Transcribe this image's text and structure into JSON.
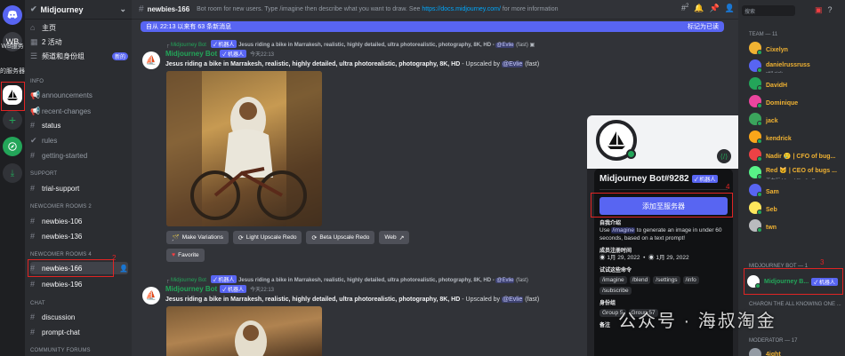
{
  "servers": {
    "items": [
      {
        "label": "discord-logo-icon"
      },
      {
        "label": "WB"
      },
      {
        "label": "Midjourney"
      },
      {
        "label": "add-server-icon"
      },
      {
        "label": "explore-icon"
      },
      {
        "label": "download-icon"
      }
    ],
    "labels": [
      "WB服务",
      "的服务器"
    ]
  },
  "guild": {
    "name": "Midjourney"
  },
  "channels": {
    "top": [
      {
        "label": "主页"
      },
      {
        "label": "2 活动"
      },
      {
        "label": "频道和身份组",
        "badge": "新的"
      }
    ],
    "cat_info": "INFO",
    "info": [
      {
        "label": "announcements"
      },
      {
        "label": "recent-changes"
      },
      {
        "label": "status"
      },
      {
        "label": "rules"
      },
      {
        "label": "getting-started"
      }
    ],
    "cat_support": "SUPPORT",
    "support": [
      {
        "label": "trial-support"
      }
    ],
    "cat_newcomer2": "NEWCOMER ROOMS 2",
    "newcomer2": [
      {
        "label": "newbies-106"
      },
      {
        "label": "newbies-136"
      }
    ],
    "cat_newcomer4": "NEWCOMER ROOMS 4",
    "newcomer4": [
      {
        "label": "newbies-166"
      },
      {
        "label": "newbies-196"
      }
    ],
    "cat_chat": "CHAT",
    "chat": [
      {
        "label": "discussion"
      },
      {
        "label": "prompt-chat"
      }
    ],
    "cat_forums": "COMMUNITY FORUMS"
  },
  "topbar": {
    "channel": "newbies-166",
    "topic": "Bot room for new users. Type /imagine then describe what you want to draw. See",
    "link": "https://docs.midjourney.com/",
    "topic_tail": "for more information",
    "threads_count": "2",
    "search_placeholder": "搜索"
  },
  "unread": {
    "text": "自从 22:13 以来有 63 条新消息",
    "mark": "标记为已读"
  },
  "messages": [
    {
      "reply_bot": "Midjourney Bot",
      "reply_badge": "✓ 机器人",
      "reply_text": "Jesus riding a bike in Marrakesh, realistic, highly detailed, ultra photorealistic, photography, 8K, HD -",
      "reply_mention": "@Evlie",
      "reply_tail": "(fast)",
      "author": "Midjourney Bot",
      "badge": "✓ 机器人",
      "time": "今天22:13",
      "prompt": "Jesus riding a bike in Marrakesh, realistic, highly detailed, ultra photorealistic, photography, 8K, HD",
      "tail": "- Upscaled by",
      "mention": "@Evlie",
      "speed": "(fast)",
      "buttons": [
        {
          "label": "Make Variations",
          "icon": "wand-icon"
        },
        {
          "label": "Light Upscale Redo",
          "icon": "refresh-icon"
        },
        {
          "label": "Beta Upscale Redo",
          "icon": "refresh-icon"
        },
        {
          "label": "Web",
          "icon": "external-link-icon"
        }
      ],
      "favorite": "Favorite"
    },
    {
      "reply_bot": "Midjourney Bot",
      "reply_badge": "✓ 机器人",
      "reply_text": "Jesus riding a bike in Marrakesh, realistic, highly detailed, ultra photorealistic, photography, 8K, HD -",
      "reply_mention": "@Evlie",
      "reply_tail": "(fast)",
      "author": "Midjourney Bot",
      "badge": "✓ 机器人",
      "time": "今天22:13",
      "prompt": "Jesus riding a bike in Marrakesh, realistic, highly detailed, ultra photorealistic, photography, 8K, HD",
      "tail": "- Upscaled by",
      "mention": "@Evlie",
      "speed": "(fast)"
    }
  ],
  "popout": {
    "name": "Midjourney Bot#9282",
    "badge": "✓ 机器人",
    "add_button": "添加至服务器",
    "about_title": "自我介绍",
    "about_pre": "Use",
    "about_cmd": "/imagine",
    "about_post": "to generate an image in under 60 seconds, based on a text prompt!",
    "since_title": "成员注册时间",
    "since_discord": "1月 29, 2022",
    "since_server": "1月 29, 2022",
    "commands_title": "试试这些命令",
    "commands": [
      "/imagine",
      "/blend",
      "/settings",
      "/info",
      "/subscribe"
    ],
    "roles_title": "身份组",
    "roles_partial": "Group 5",
    "roles_partial2": "Group 57",
    "note_title": "备注"
  },
  "members": {
    "team_header": "TEAM — 11",
    "team": [
      {
        "name": "Cixelyn",
        "color": "#f0b232"
      },
      {
        "name": "danielrussruss",
        "sub": "still sick",
        "color": "#f0b232"
      },
      {
        "name": "DavidH",
        "color": "#f0b232"
      },
      {
        "name": "Dominique",
        "color": "#f0b232"
      },
      {
        "name": "jack",
        "color": "#f0b232"
      },
      {
        "name": "kendrick",
        "color": "#f0b232"
      },
      {
        "name": "Nadir 🥲 | CFO of bug...",
        "color": "#f0b232"
      },
      {
        "name": "Red 🐱 | CEO of bugs ...",
        "sub": "正在玩 Visual Studio C...",
        "color": "#f0b232"
      },
      {
        "name": "Sam",
        "color": "#f0b232"
      },
      {
        "name": "Seb",
        "color": "#f0b232"
      },
      {
        "name": "twn",
        "color": "#f0b232"
      }
    ],
    "bot_header": "MIDJOURNEY BOT — 1",
    "bot": {
      "name": "Midjourney B...",
      "badge": "✓ 机器人"
    },
    "charon_header": "CHARON THE ALL KNOWING ONE ...",
    "mod_header": "MODERATOR — 17",
    "mod_partial": "4ight"
  },
  "annotations": {
    "n2": "2",
    "n3": "3",
    "n4": "4",
    "n1": "1"
  },
  "watermark": "公众号 · 海叔淘金"
}
